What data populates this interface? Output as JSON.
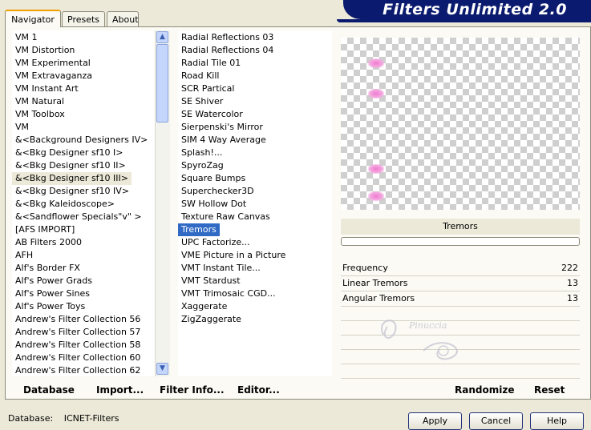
{
  "tabs": [
    "Navigator",
    "Presets",
    "About"
  ],
  "banner_title": "Filters Unlimited 2.0",
  "categories": [
    "VM 1",
    "VM Distortion",
    "VM Experimental",
    "VM Extravaganza",
    "VM Instant Art",
    "VM Natural",
    "VM Toolbox",
    "VM",
    "&<Background Designers IV>",
    "&<Bkg Designer sf10 I>",
    "&<Bkg Designer sf10 II>",
    "&<Bkg Designer sf10 III>",
    "&<Bkg Designer sf10 IV>",
    "&<Bkg Kaleidoscope>",
    "&<Sandflower Specials\"v\" >",
    "[AFS IMPORT]",
    "AB Filters 2000",
    "AFH",
    "Alf's Border FX",
    "Alf's Power Grads",
    "Alf's Power Sines",
    "Alf's Power Toys",
    "Andrew's Filter Collection 56",
    "Andrew's Filter Collection 57",
    "Andrew's Filter Collection 58",
    "Andrew's Filter Collection 60",
    "Andrew's Filter Collection 62"
  ],
  "selected_category": "&<Bkg Designer sf10 III>",
  "filters": [
    "Radial Reflections 03",
    "Radial Reflections 04",
    "Radial Tile 01",
    "Road Kill",
    "SCR  Partical",
    "SE Shiver",
    "SE Watercolor",
    "Sierpenski's Mirror",
    "SIM 4 Way Average",
    "Splash!...",
    "SpyroZag",
    "Square Bumps",
    "Superchecker3D",
    "SW Hollow Dot",
    "Texture Raw Canvas",
    "Tremors",
    "UPC Factorize...",
    "VME Picture in a Picture",
    "VMT Instant Tile...",
    "VMT Stardust",
    "VMT Trimosaic CGD...",
    "Xaggerate",
    "ZigZaggerate"
  ],
  "selected_filter": "Tremors",
  "filter_label": "Tremors",
  "params": [
    {
      "name": "Frequency",
      "value": "222"
    },
    {
      "name": "Linear Tremors",
      "value": "13"
    },
    {
      "name": "Angular Tremors",
      "value": "13"
    }
  ],
  "watermark_text": "Pinuccia",
  "bottom_links": {
    "database": "Database",
    "import": "Import...",
    "filter_info": "Filter Info...",
    "editor": "Editor...",
    "randomize": "Randomize",
    "reset": "Reset"
  },
  "status": {
    "label": "Database:",
    "value": "ICNET-Filters"
  },
  "buttons": {
    "apply": "Apply",
    "cancel": "Cancel",
    "help": "Help"
  },
  "colors": {
    "banner": "#0a1a6e",
    "selection": "#316ac5",
    "tab_accent": "#f0a000"
  },
  "icons": {
    "scroll_up": "scroll-up-arrow-icon",
    "scroll_down": "scroll-down-arrow-icon"
  }
}
